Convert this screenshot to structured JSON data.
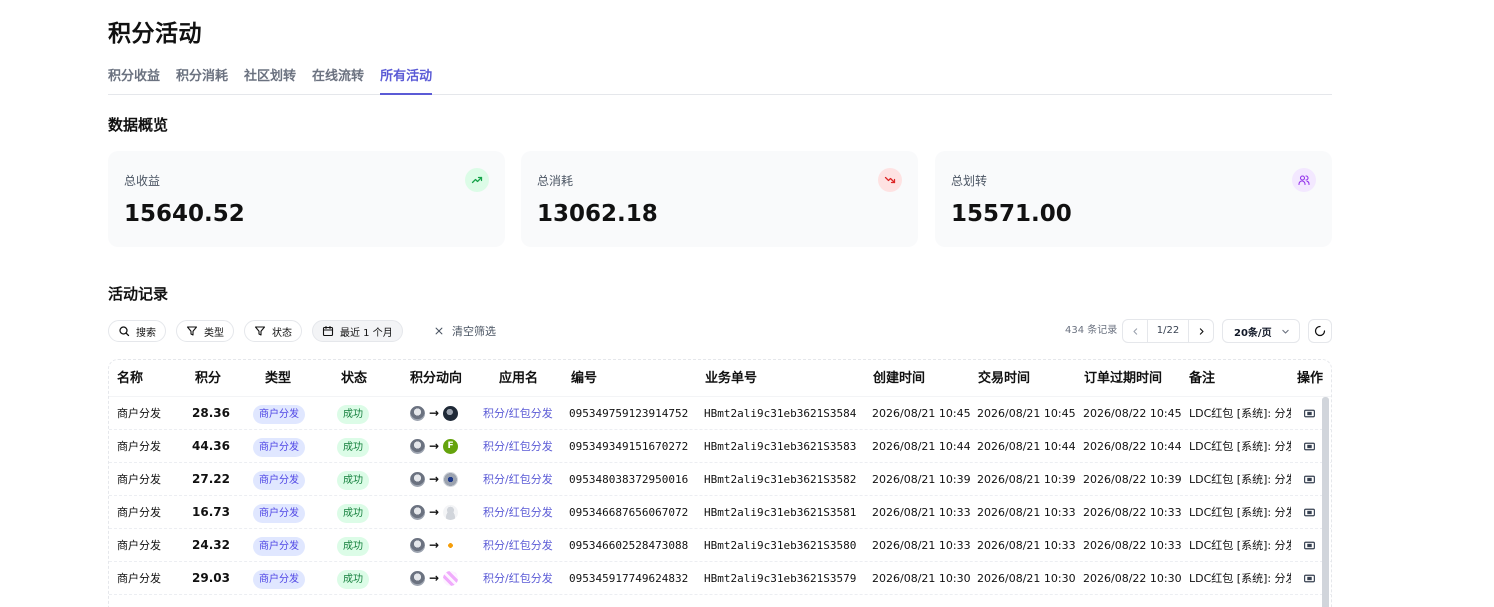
{
  "page_title": "积分活动",
  "tabs": [
    {
      "label": "积分收益",
      "active": false
    },
    {
      "label": "积分消耗",
      "active": false
    },
    {
      "label": "社区划转",
      "active": false
    },
    {
      "label": "在线流转",
      "active": false
    },
    {
      "label": "所有活动",
      "active": true
    }
  ],
  "overview": {
    "title": "数据概览",
    "cards": [
      {
        "label": "总收益",
        "value": "15640.52",
        "icon": "trending-up-icon",
        "icon_bg": "#dcfce7",
        "icon_color": "#16a34a"
      },
      {
        "label": "总消耗",
        "value": "13062.18",
        "icon": "trending-down-icon",
        "icon_bg": "#fee2e2",
        "icon_color": "#dc2626"
      },
      {
        "label": "总划转",
        "value": "15571.00",
        "icon": "users-icon",
        "icon_bg": "#f3e8ff",
        "icon_color": "#9333ea"
      }
    ]
  },
  "activity": {
    "title": "活动记录",
    "filters": {
      "search": "搜索",
      "type": "类型",
      "status": "状态",
      "date": "最近 1 个月",
      "clear": "清空筛选"
    },
    "records": "434 条记录",
    "page": "1/22",
    "page_size": "20条/页",
    "columns": [
      "名称",
      "积分",
      "类型",
      "状态",
      "积分动向",
      "应用名",
      "编号",
      "业务单号",
      "创建时间",
      "交易时间",
      "订单过期时间",
      "备注",
      "操作"
    ],
    "rows": [
      {
        "name": "商户分发",
        "points": "28.36",
        "type": "商户分发",
        "status": "成功",
        "to_avatar": "avatar-dark",
        "app": "积分/红包分发",
        "no": "095349759123914752",
        "biz": "HBmt2ali9c31eb3621S3584",
        "created": "2026/08/21 10:45",
        "trade": "2026/08/21 10:45",
        "expire": "2026/08/22 10:45",
        "note": "LDC红包 [系统]: 分发"
      },
      {
        "name": "商户分发",
        "points": "44.36",
        "type": "商户分发",
        "status": "成功",
        "to_avatar": "avatar-letter-f",
        "to_letter": "F",
        "app": "积分/红包分发",
        "no": "095349349151670272",
        "biz": "HBmt2ali9c31eb3621S3583",
        "created": "2026/08/21 10:44",
        "trade": "2026/08/21 10:44",
        "expire": "2026/08/22 10:44",
        "note": "LDC红包 [系统]: 分发"
      },
      {
        "name": "商户分发",
        "points": "27.22",
        "type": "商户分发",
        "status": "成功",
        "to_avatar": "avatar-blue",
        "app": "积分/红包分发",
        "no": "095348038372950016",
        "biz": "HBmt2ali9c31eb3621S3582",
        "created": "2026/08/21 10:39",
        "trade": "2026/08/21 10:39",
        "expire": "2026/08/22 10:39",
        "note": "LDC红包 [系统]: 分发"
      },
      {
        "name": "商户分发",
        "points": "16.73",
        "type": "商户分发",
        "status": "成功",
        "to_avatar": "avatar-default",
        "app": "积分/红包分发",
        "no": "095346687656067072",
        "biz": "HBmt2ali9c31eb3621S3581",
        "created": "2026/08/21 10:33",
        "trade": "2026/08/21 10:33",
        "expire": "2026/08/22 10:33",
        "note": "LDC红包 [系统]: 分发"
      },
      {
        "name": "商户分发",
        "points": "24.32",
        "type": "商户分发",
        "status": "成功",
        "to_avatar": "avatar-sun",
        "app": "积分/红包分发",
        "no": "095346602528473088",
        "biz": "HBmt2ali9c31eb3621S3580",
        "created": "2026/08/21 10:33",
        "trade": "2026/08/21 10:33",
        "expire": "2026/08/22 10:33",
        "note": "LDC红包 [系统]: 分发"
      },
      {
        "name": "商户分发",
        "points": "29.03",
        "type": "商户分发",
        "status": "成功",
        "to_avatar": "avatar-pattern",
        "app": "积分/红包分发",
        "no": "095345917749624832",
        "biz": "HBmt2ali9c31eb3621S3579",
        "created": "2026/08/21 10:30",
        "trade": "2026/08/21 10:30",
        "expire": "2026/08/22 10:30",
        "note": "LDC红包 [系统]: 分发"
      }
    ]
  }
}
